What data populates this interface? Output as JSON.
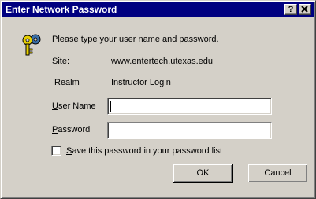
{
  "window": {
    "title": "Enter Network Password",
    "help_button": "?",
    "close_button": "✕"
  },
  "prompt": "Please type your user name and password.",
  "site": {
    "label": "Site:",
    "value": "www.entertech.utexas.edu"
  },
  "realm": {
    "label": "Realm",
    "value": "Instructor Login"
  },
  "username": {
    "label_key": "U",
    "label_rest": "ser Name",
    "value": ""
  },
  "password": {
    "label_key": "P",
    "label_rest": "assword",
    "value": ""
  },
  "save_checkbox": {
    "label_key": "S",
    "label_rest": "ave this password in your password list",
    "checked": false
  },
  "buttons": {
    "ok": "OK",
    "cancel": "Cancel"
  },
  "colors": {
    "titlebar": "#000080",
    "face": "#d4d0c8"
  },
  "icon": "keys-icon"
}
